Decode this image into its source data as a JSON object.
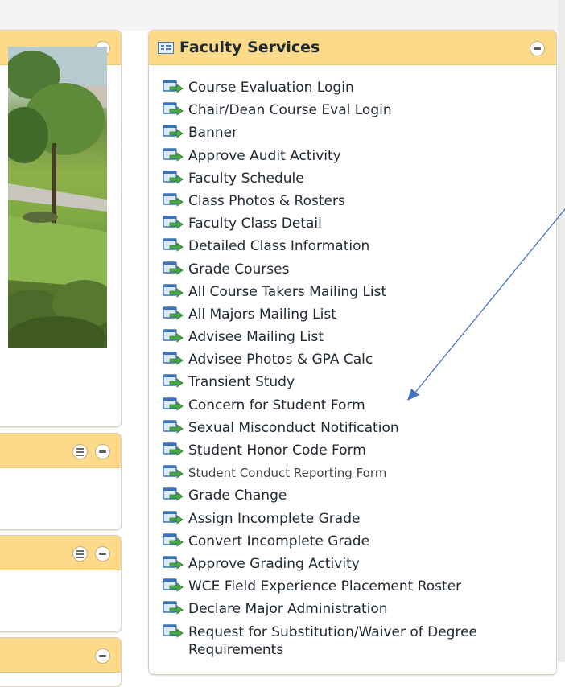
{
  "faculty_services": {
    "title": "Faculty Services",
    "links": [
      "Course Evaluation Login",
      "Chair/Dean Course Eval Login",
      "Banner",
      "Approve Audit Activity",
      "Faculty Schedule",
      "Class Photos & Rosters",
      "Faculty Class Detail",
      "Detailed Class Information",
      "Grade Courses",
      "All Course Takers Mailing List",
      "All Majors Mailing List",
      "Advisee Mailing List",
      "Advisee Photos & GPA Calc",
      "Transient Study",
      "Concern for Student Form",
      "Sexual Misconduct Notification",
      "Student Honor Code Form",
      "Student Conduct Reporting Form",
      "Grade Change",
      "Assign Incomplete Grade",
      "Convert Incomplete Grade",
      "Approve Grading Activity",
      "WCE Field Experience Placement Roster",
      "Declare Major Administration",
      "Request for Substitution/Waiver of Degree Requirements"
    ]
  },
  "annotation": {
    "color": "#4472c4",
    "points_to": "Concern for Student Form"
  },
  "colors": {
    "panel_header": "#fdd98a",
    "link_text": "#222a33",
    "icon_blue": "#3b73b9",
    "icon_green": "#47a845"
  }
}
